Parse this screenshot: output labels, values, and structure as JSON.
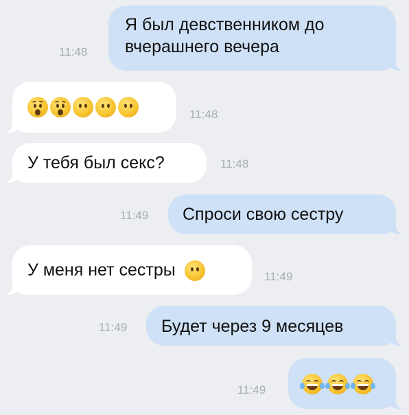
{
  "messages": [
    {
      "direction": "outgoing",
      "lines": [
        "Я был девственником до",
        "вчерашнего вечера"
      ],
      "time": "11:48"
    },
    {
      "direction": "incoming",
      "emoji": [
        "hushed-face-emoji",
        "hushed-face-emoji",
        "face-without-mouth-emoji",
        "face-without-mouth-emoji",
        "face-without-mouth-emoji"
      ],
      "time": "11:48"
    },
    {
      "direction": "incoming",
      "text": "У тебя был секс?",
      "time": "11:48"
    },
    {
      "direction": "outgoing",
      "text": "Спроси свою сестру",
      "time": "11:49"
    },
    {
      "direction": "incoming",
      "text": "У меня нет сестры",
      "emoji": [
        "face-without-mouth-emoji"
      ],
      "time": "11:49"
    },
    {
      "direction": "outgoing",
      "text": "Будет через 9 месяцев",
      "time": "11:49"
    },
    {
      "direction": "outgoing",
      "emoji": [
        "tears-of-joy-emoji",
        "tears-of-joy-emoji",
        "tears-of-joy-emoji"
      ],
      "time": "11:49"
    }
  ],
  "colors": {
    "background": "#eceef1",
    "incoming_bubble": "#ffffff",
    "outgoing_bubble": "#cfe1f6",
    "timestamp": "#a9adb4",
    "text": "#111111"
  }
}
